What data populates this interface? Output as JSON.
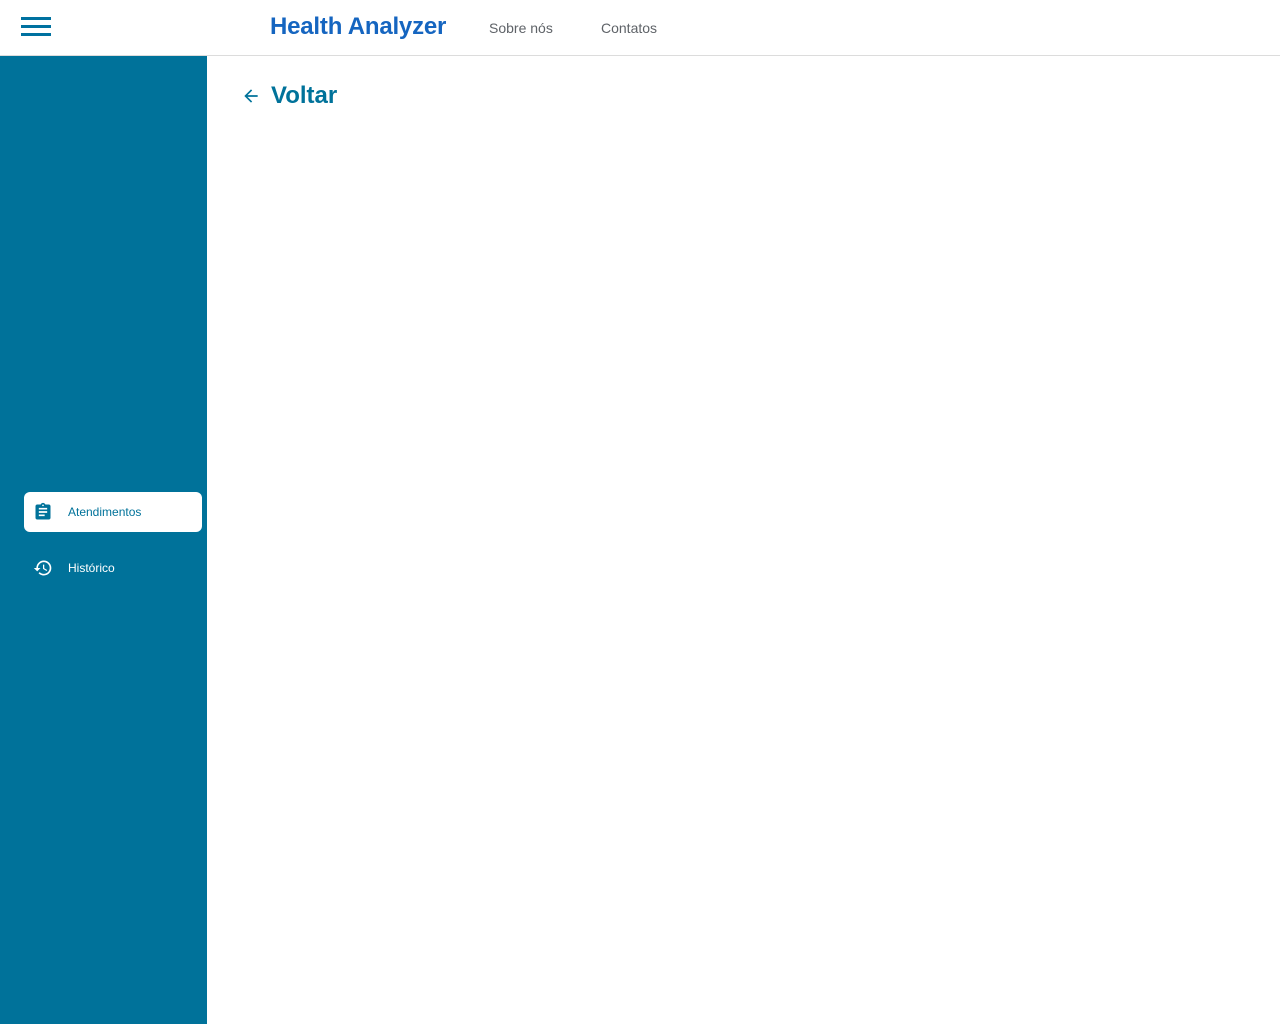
{
  "header": {
    "brand": "Health Analyzer",
    "menu_icon": "hamburger-menu-icon",
    "links": [
      "Sobre nós",
      "Contatos"
    ]
  },
  "sidebar": {
    "items": [
      {
        "label": "Atendimentos",
        "icon": "clipboard-icon",
        "active": true
      },
      {
        "label": "Histórico",
        "icon": "history-icon",
        "active": false
      }
    ]
  },
  "main": {
    "back_label": "Voltar",
    "back_icon": "arrow-left-icon"
  },
  "colors": {
    "primary": "#00729a",
    "brand": "#1565c0",
    "nav_text": "#5f6368",
    "background": "#ffffff"
  }
}
